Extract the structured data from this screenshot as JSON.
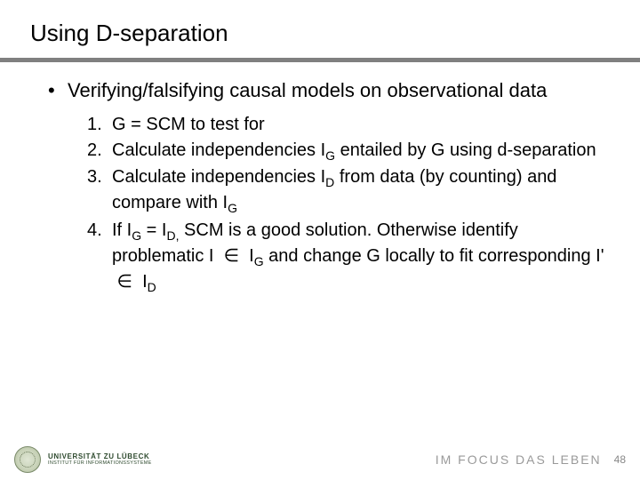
{
  "title": "Using D-separation",
  "bullet": "Verifying/falsifying causal models on observational data",
  "items": [
    {
      "num": "1",
      "html": "G = SCM to test for"
    },
    {
      "num": "2",
      "html": "Calculate independencies I<span class=\"sub\">G</span> entailed by G using d-separation"
    },
    {
      "num": "3",
      "html": "Calculate independencies I<span class=\"sub\">D</span> from data (by counting) and compare with I<span class=\"sub\">G</span>"
    },
    {
      "num": "4",
      "html": "If I<span class=\"sub\">G</span> = I<span class=\"sub\">D,</span> SCM is a good solution. Otherwise identify problematic I &nbsp;∈ &nbsp;I<span class=\"sub\">G</span> and change G locally to fit corresponding I' &nbsp;∈ &nbsp;I<span class=\"sub\">D</span>"
    }
  ],
  "footer": {
    "uni_line1": "UNIVERSITÄT ZU LÜBECK",
    "uni_line2": "INSTITUT FÜR INFORMATIONSSYSTEME",
    "tagline": "IM FOCUS DAS LEBEN",
    "page": "48"
  }
}
